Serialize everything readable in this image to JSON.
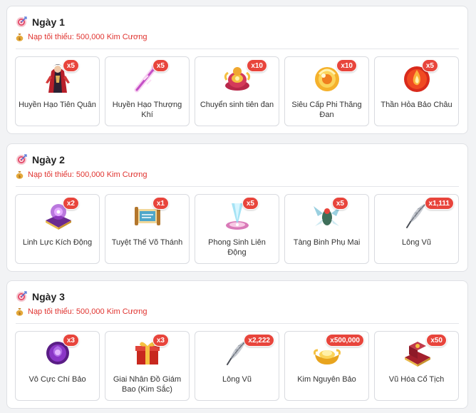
{
  "days": [
    {
      "title": "Ngày 1",
      "requirement": "Nạp tối thiểu: 500,000 Kim Cương",
      "items": [
        {
          "name": "Huyền Hạo Tiên Quân",
          "qty": "x5",
          "icon": "robed-warrior-icon"
        },
        {
          "name": "Huyền Hạo Thượng Khí",
          "qty": "x5",
          "icon": "glowing-staff-icon"
        },
        {
          "name": "Chuyển sinh tiên đan",
          "qty": "x10",
          "icon": "ornate-censer-icon"
        },
        {
          "name": "Siêu Cấp Phi Thăng Đan",
          "qty": "x10",
          "icon": "golden-orb-icon"
        },
        {
          "name": "Thần Hỏa Bảo Châu",
          "qty": "x5",
          "icon": "fire-pearl-icon"
        }
      ]
    },
    {
      "title": "Ngày 2",
      "requirement": "Nạp tối thiểu: 500,000 Kim Cương",
      "items": [
        {
          "name": "Linh Lực Kích Động",
          "qty": "x2",
          "icon": "purple-spellbook-icon"
        },
        {
          "name": "Tuyệt Thế Võ Thánh",
          "qty": "x1",
          "icon": "scroll-icon"
        },
        {
          "name": "Phong Sinh Liên Động",
          "qty": "x5",
          "icon": "crystal-chalice-icon"
        },
        {
          "name": "Tàng Binh Phụ Mai",
          "qty": "x5",
          "icon": "winged-spirit-icon"
        },
        {
          "name": "Lông Vũ",
          "qty": "x1,111",
          "icon": "feather-icon"
        }
      ]
    },
    {
      "title": "Ngày 3",
      "requirement": "Nạp tối thiểu: 500,000 Kim Cương",
      "items": [
        {
          "name": "Vô Cực Chí Bảo",
          "qty": "x3",
          "icon": "purple-rose-icon"
        },
        {
          "name": "Giai Nhân Đồ Giám Bao (Kim Sắc)",
          "qty": "x3",
          "icon": "gift-box-icon"
        },
        {
          "name": "Lông Vũ",
          "qty": "x2,222",
          "icon": "feather-icon"
        },
        {
          "name": "Kim Nguyên Bảo",
          "qty": "x500,000",
          "icon": "gold-ingot-icon"
        },
        {
          "name": "Vũ Hóa Cổ Tịch",
          "qty": "x50",
          "icon": "red-tome-icon"
        }
      ]
    }
  ],
  "colors": {
    "accent_red": "#e0332f",
    "badge_red": "#e8453c",
    "card_border": "#dfe1e5"
  }
}
